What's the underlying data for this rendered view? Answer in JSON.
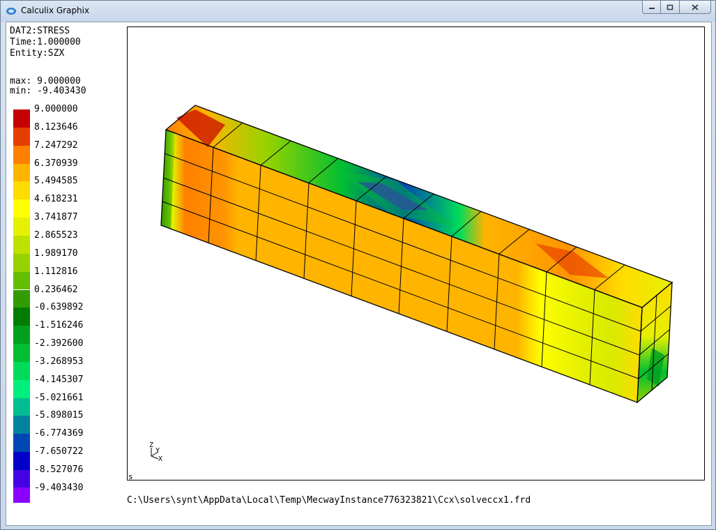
{
  "window": {
    "title": "Calculix Graphix",
    "minimize_icon": "minimize-icon",
    "maximize_icon": "maximize-icon",
    "close_icon": "close-icon"
  },
  "result_info": {
    "dataset": "DAT2:STRESS",
    "time": "Time:1.000000",
    "entity": "Entity:SZX",
    "max": "max: 9.000000",
    "min": "min: -9.403430"
  },
  "legend": [
    {
      "value": "9.000000",
      "color": "#c40000"
    },
    {
      "value": "8.123646",
      "color": "#e63c00"
    },
    {
      "value": "7.247292",
      "color": "#ff8000"
    },
    {
      "value": "6.370939",
      "color": "#ffb400"
    },
    {
      "value": "5.494585",
      "color": "#ffdc00"
    },
    {
      "value": "4.618231",
      "color": "#ffff00"
    },
    {
      "value": "3.741877",
      "color": "#e6f000"
    },
    {
      "value": "2.865523",
      "color": "#bee100"
    },
    {
      "value": "1.989170",
      "color": "#96d200"
    },
    {
      "value": "1.112816",
      "color": "#64be00"
    },
    {
      "value": "0.236462",
      "color": "#329b00"
    },
    {
      "value": "-0.639892",
      "color": "#007d00"
    },
    {
      "value": "-1.516246",
      "color": "#00a01e"
    },
    {
      "value": "-2.392600",
      "color": "#00be32"
    },
    {
      "value": "-3.268953",
      "color": "#00dc5a"
    },
    {
      "value": "-4.145307",
      "color": "#00f07d"
    },
    {
      "value": "-5.021661",
      "color": "#00be91"
    },
    {
      "value": "-5.898015",
      "color": "#0082a0"
    },
    {
      "value": "-6.774369",
      "color": "#0046b4"
    },
    {
      "value": "-7.650722",
      "color": "#0000c8"
    },
    {
      "value": "-8.527076",
      "color": "#4600e6"
    },
    {
      "value": "-9.403430",
      "color": "#8c00ff"
    }
  ],
  "viewport": {
    "corner_mark": "s",
    "axis_labels": {
      "z": "Z",
      "y": "Y",
      "x": "X"
    }
  },
  "status": {
    "file_path": "C:\\Users\\synt\\AppData\\Local\\Temp\\MecwayInstance776323821\\Ccx\\solveccx1.frd"
  }
}
